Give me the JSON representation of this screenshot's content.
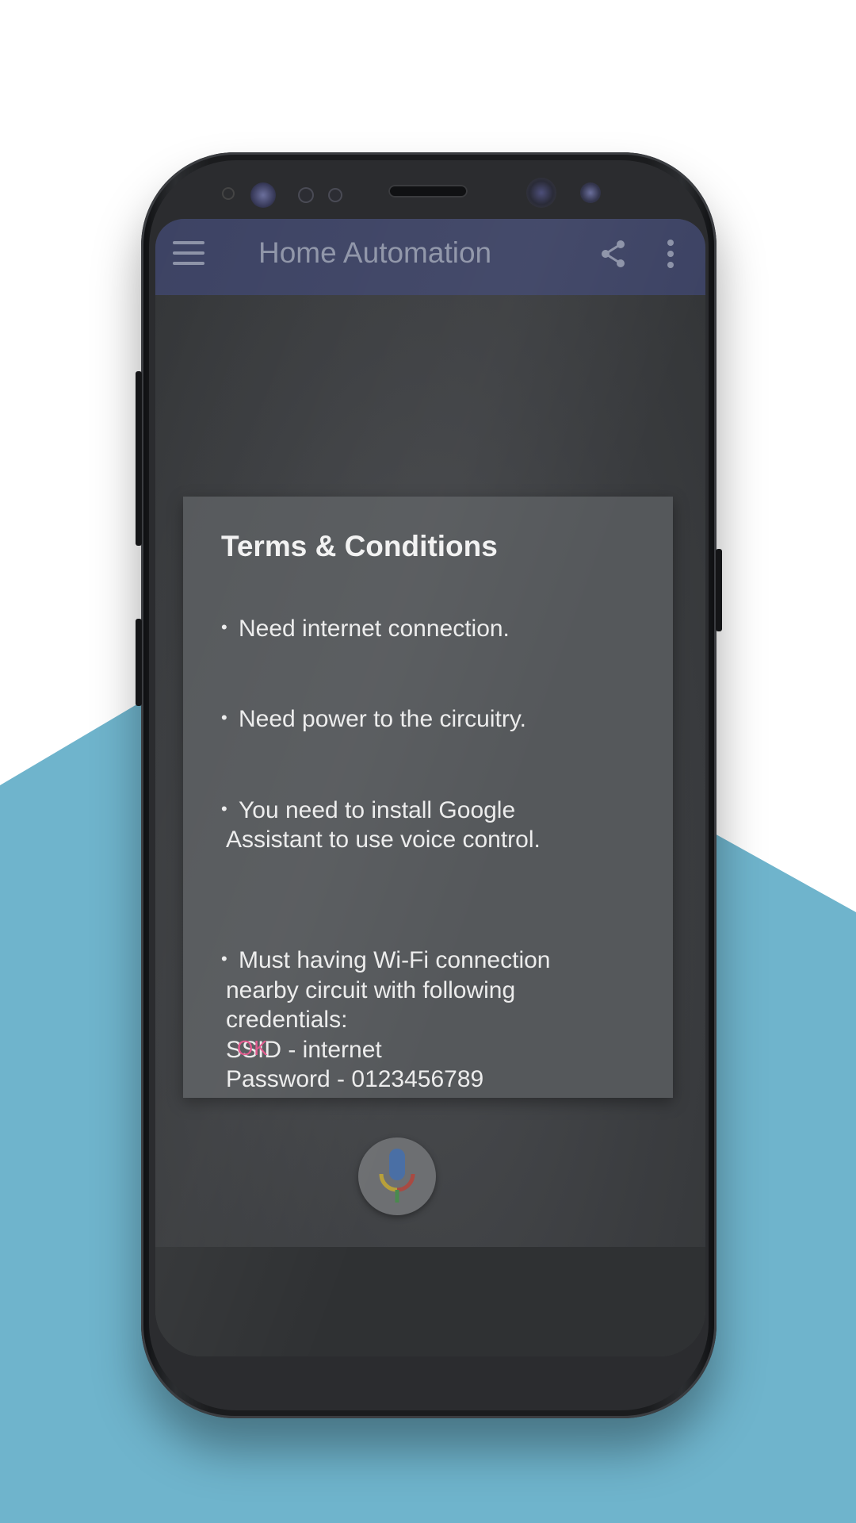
{
  "colors": {
    "background": "#ffffff",
    "accent_band": "#6fb4cc",
    "app_bar": "#3d4364",
    "dialog_bg": "#55585b",
    "ok_button": "#e0558a"
  },
  "app_bar": {
    "title": "Home Automation",
    "menu_icon": "hamburger-menu-icon",
    "share_icon": "share-icon",
    "more_icon": "more-vertical-icon"
  },
  "dialog": {
    "title": "Terms & Conditions",
    "terms": [
      {
        "first_line": "Need internet connection.",
        "rest": ""
      },
      {
        "first_line": "Need power to the circuitry.",
        "rest": ""
      },
      {
        "first_line": "You need to install Google",
        "rest": "Assistant to use voice control."
      },
      {
        "first_line": "Must having Wi-Fi connection",
        "rest": "nearby circuit with following\ncredentials:\nSSID - internet\nPassword - 0123456789"
      }
    ],
    "ok_label": "OK"
  },
  "mic": {
    "icon": "google-mic-icon"
  }
}
